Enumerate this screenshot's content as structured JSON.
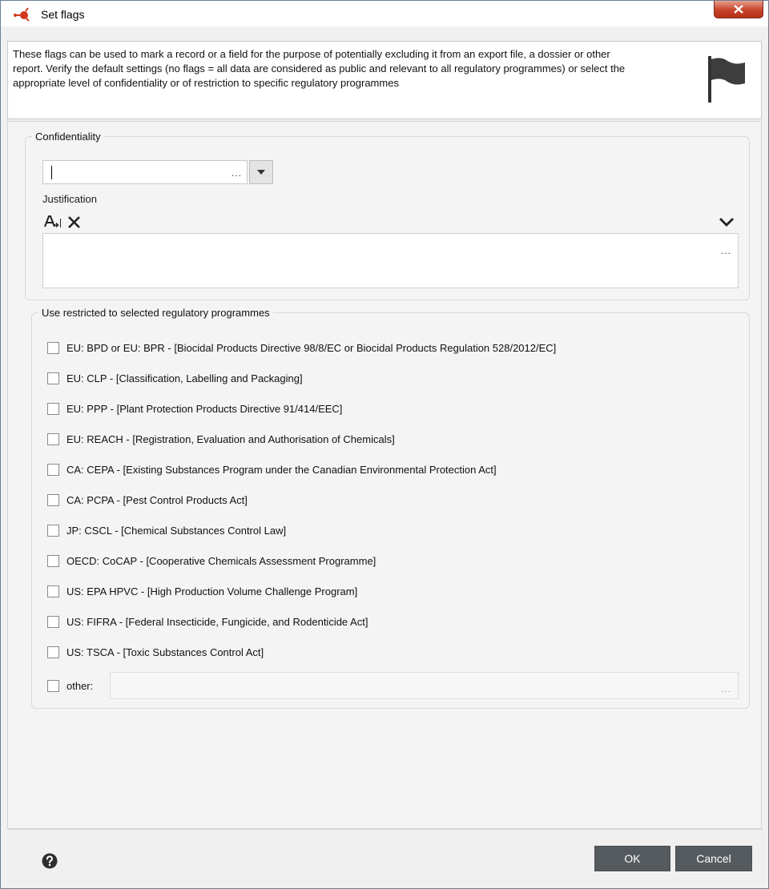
{
  "window": {
    "title": "Set flags",
    "close_label": "x"
  },
  "info": {
    "text": "These flags can be used to mark a record or a field for the purpose of potentially excluding it from an export file, a dossier or other report. Verify the default settings (no flags = all data are considered as public and relevant to all regulatory programmes) or select the appropriate level of confidentiality or of restriction to specific regulatory programmes"
  },
  "confidentiality": {
    "legend": "Confidentiality",
    "selected_value": "",
    "ellipsis": "...",
    "justification_label": "Justification",
    "justification_value": "",
    "justification_ellipsis": "..."
  },
  "regulatory": {
    "legend": "Use restricted to selected regulatory programmes",
    "items": [
      {
        "label": "EU: BPD or EU: BPR - [Biocidal Products Directive 98/8/EC or Biocidal Products Regulation 528/2012/EC]",
        "checked": false
      },
      {
        "label": "EU: CLP - [Classification, Labelling and Packaging]",
        "checked": false
      },
      {
        "label": "EU: PPP - [Plant Protection Products Directive 91/414/EEC]",
        "checked": false
      },
      {
        "label": "EU: REACH - [Registration, Evaluation and Authorisation of Chemicals]",
        "checked": false
      },
      {
        "label": "CA: CEPA - [Existing Substances Program under the Canadian Environmental Protection Act]",
        "checked": false
      },
      {
        "label": "CA: PCPA - [Pest Control Products Act]",
        "checked": false
      },
      {
        "label": "JP: CSCL - [Chemical Substances Control Law]",
        "checked": false
      },
      {
        "label": "OECD: CoCAP - [Cooperative Chemicals Assessment Programme]",
        "checked": false
      },
      {
        "label": "US: EPA HPVC - [High Production Volume Challenge Program]",
        "checked": false
      },
      {
        "label": "US: FIFRA - [Federal Insecticide, Fungicide, and Rodenticide Act]",
        "checked": false
      },
      {
        "label": "US: TSCA - [Toxic Substances Control Act]",
        "checked": false
      }
    ],
    "other_label": "other:",
    "other_value": "",
    "other_ellipsis": "..."
  },
  "footer": {
    "ok_label": "OK",
    "cancel_label": "Cancel"
  },
  "icons": {
    "app": "app-logo-icon",
    "close": "close-icon",
    "flag": "flag-icon",
    "dropdown": "chevron-down-icon",
    "format": "format-text-icon",
    "clear": "clear-icon",
    "expand": "chevron-down-icon",
    "help": "help-icon"
  },
  "colors": {
    "button_bg": "#555a5f",
    "close_bg": "#c7432a",
    "app_icon": "#d23a1e"
  }
}
